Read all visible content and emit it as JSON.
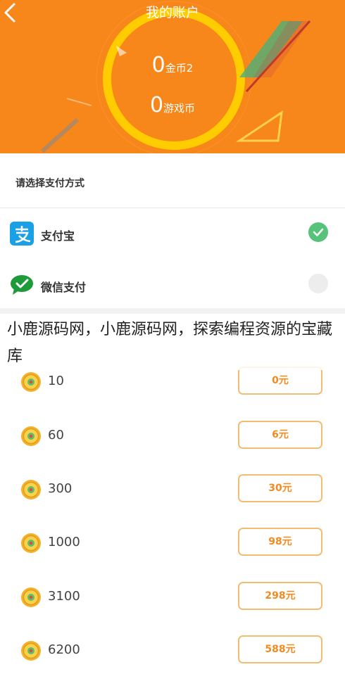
{
  "header": {
    "title": "我的账户",
    "balances": [
      {
        "value": "0",
        "unit": "金币2"
      },
      {
        "value": "0",
        "unit": "游戏币"
      }
    ]
  },
  "payment": {
    "heading": "请选择支付方式",
    "methods": [
      {
        "label": "支付宝",
        "icon": "alipay-icon",
        "selected": true
      },
      {
        "label": "微信支付",
        "icon": "wechat-icon",
        "selected": false
      }
    ]
  },
  "watermark": "小鹿源码网，小鹿源码网，探索编程资源的宝藏库",
  "packages": [
    {
      "amount": "10",
      "price": "0元"
    },
    {
      "amount": "60",
      "price": "6元"
    },
    {
      "amount": "300",
      "price": "30元"
    },
    {
      "amount": "1000",
      "price": "98元"
    },
    {
      "amount": "3100",
      "price": "298元"
    },
    {
      "amount": "6200",
      "price": "588元"
    }
  ],
  "colors": {
    "primary": "#f7861b",
    "ring": "#ffcc00",
    "accent_border": "#f1bd73",
    "price_text": "#f28a22",
    "check": "#57c27a"
  }
}
